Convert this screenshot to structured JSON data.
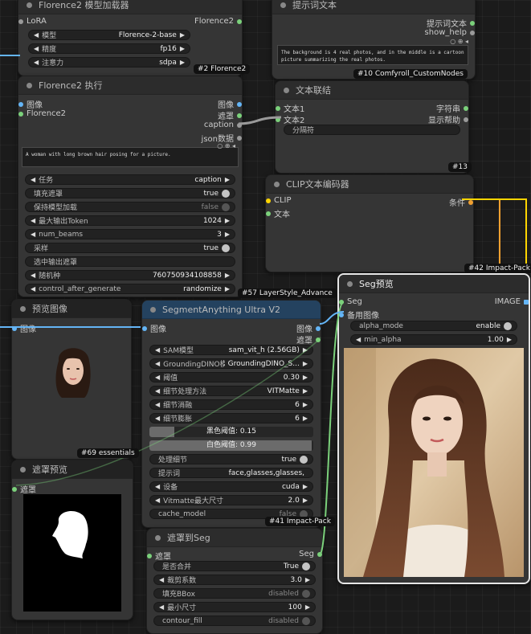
{
  "nodes": {
    "florence_loader": {
      "title": "Florence2 模型加载器",
      "in_label": "LoRA",
      "out_label": "Florence2",
      "widgets": [
        {
          "label": "模型",
          "value": "Florence-2-base"
        },
        {
          "label": "精度",
          "value": "fp16"
        },
        {
          "label": "注意力",
          "value": "sdpa"
        }
      ],
      "badge": "#2 Florence2"
    },
    "prompt_text": {
      "title": "提示词文本",
      "outputs": [
        "提示词文本",
        "show_help"
      ],
      "text": "The background is 4 real photos, and in the middle is a cartoon picture summarizing the real photos.",
      "badge": "#10 Comfyroll_CustomNodes"
    },
    "florence_run": {
      "title": "Florence2 执行",
      "inputs": [
        "图像",
        "Florence2"
      ],
      "outputs": [
        "图像",
        "遮罩",
        "caption",
        "json数据"
      ],
      "text": "A woman with long brown hair posing for a picture.",
      "widgets": [
        {
          "label": "任务",
          "value": "caption"
        },
        {
          "label": "填充遮罩",
          "value": "true"
        },
        {
          "label": "保持模型加载",
          "value": "false"
        },
        {
          "label": "最大输出Token",
          "value": "1024"
        },
        {
          "label": "num_beams",
          "value": "3"
        },
        {
          "label": "采样",
          "value": "true"
        },
        {
          "label": "选中输出遮罩",
          "value": ""
        },
        {
          "label": "随机种",
          "value": "760750934108858"
        },
        {
          "label": "control_after_generate",
          "value": "randomize"
        }
      ]
    },
    "text_concat": {
      "title": "文本联结",
      "inputs": [
        "文本1",
        "文本2"
      ],
      "outputs": [
        "字符串",
        "显示帮助"
      ],
      "sep_label": "分隔符",
      "badge": "#13"
    },
    "clip_encoder": {
      "title": "CLIP文本编码器",
      "inputs": [
        "CLIP",
        "文本"
      ],
      "output": "条件",
      "badge": "#42 Impact-Pack"
    },
    "preview_image": {
      "title": "预览图像",
      "input": "图像",
      "badge": "#69 essentials"
    },
    "segment": {
      "title": "SegmentAnything Ultra V2",
      "partial_badge": "#57 LayerStyle_Advance",
      "input": "图像",
      "outputs": [
        "图像",
        "遮罩"
      ],
      "widgets": [
        {
          "label": "SAM模型",
          "value": "sam_vit_h (2.56GB)"
        },
        {
          "label": "GroundingDINO模型",
          "value": "GroundingDINO_S..."
        },
        {
          "label": "阈值",
          "value": "0.30"
        },
        {
          "label": "细节处理方法",
          "value": "VITMatte"
        },
        {
          "label": "细节消融",
          "value": "6"
        },
        {
          "label": "细节膨胀",
          "value": "6"
        }
      ],
      "black_point_label": "黑色阈值: 0.15",
      "black_point": 0.15,
      "white_point_label": "白色阈值: 0.99",
      "white_point": 0.99,
      "widgets2": [
        {
          "label": "处理细节",
          "value": "true"
        },
        {
          "label": "提示词",
          "value": "face,glasses,glasses,"
        },
        {
          "label": "设备",
          "value": "cuda"
        },
        {
          "label": "Vitmatte最大尺寸",
          "value": "2.0"
        },
        {
          "label": "cache_model",
          "value": "false"
        }
      ],
      "badge": "#41 Impact-Pack"
    },
    "mask_preview": {
      "title": "遮罩预览",
      "input": "遮罩"
    },
    "mask_to_seg": {
      "title": "遮罩到Seg",
      "input": "遮罩",
      "output": "Seg",
      "widgets": [
        {
          "label": "是否合并",
          "value": "True"
        },
        {
          "label": "裁剪系数",
          "value": "3.0"
        },
        {
          "label": "填充BBox",
          "value": "disabled"
        },
        {
          "label": "最小尺寸",
          "value": "100"
        },
        {
          "label": "contour_fill",
          "value": "disabled"
        }
      ]
    },
    "seg_preview": {
      "title": "Seg预览",
      "inputs": [
        "Seg",
        "备用图像"
      ],
      "output": "IMAGE",
      "widgets": [
        {
          "label": "alpha_mode",
          "value": "enable"
        },
        {
          "label": "min_alpha",
          "value": "1.00"
        }
      ]
    }
  },
  "colors": {
    "image_port": "#64b5f6",
    "mask_port": "#7bd17b",
    "clip_port": "#ffd500",
    "cond_port": "#f0a030",
    "selected_border": "#e6e6e6"
  }
}
